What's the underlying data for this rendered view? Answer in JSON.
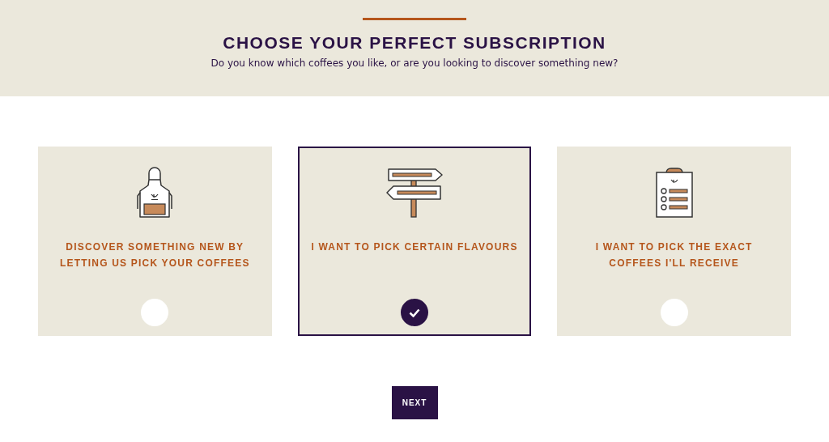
{
  "header": {
    "title": "CHOOSE YOUR PERFECT SUBSCRIPTION",
    "subtitle": "Do you know which coffees you like, or are you looking to discover something new?"
  },
  "options": [
    {
      "kind": "apron",
      "label": "DISCOVER SOMETHING NEW BY LETTING US PICK YOUR COFFEES",
      "selected": false
    },
    {
      "kind": "signpost",
      "label": "I WANT TO PICK CERTAIN FLAVOURS",
      "selected": true
    },
    {
      "kind": "clipboard",
      "label": "I WANT TO PICK THE EXACT COFFEES I'LL RECEIVE",
      "selected": false
    }
  ],
  "next_button": "NEXT"
}
